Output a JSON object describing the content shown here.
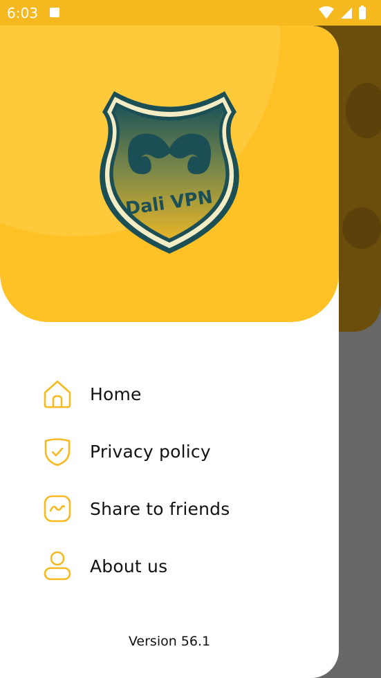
{
  "status_bar": {
    "time": "6:03",
    "icons": [
      "app-notification-icon",
      "wifi-icon",
      "signal-icon",
      "battery-icon"
    ]
  },
  "drawer": {
    "logo_text": "Dali VPN",
    "menu": [
      {
        "label": "Home",
        "icon": "home-icon"
      },
      {
        "label": "Privacy policy",
        "icon": "shield-check-icon"
      },
      {
        "label": "Share to friends",
        "icon": "share-wave-icon"
      },
      {
        "label": "About us",
        "icon": "user-icon"
      }
    ],
    "version": "Version 56.1"
  },
  "colors": {
    "accent": "#ffc226",
    "status_bar": "#f6b81f",
    "icon": "#f6b91f",
    "scrim": "#676767"
  }
}
